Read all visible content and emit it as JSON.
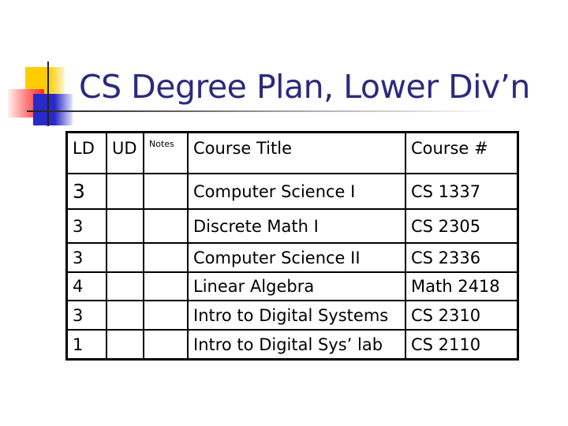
{
  "slide": {
    "title": "CS Degree Plan, Lower Div’n",
    "decoration_colors": {
      "yellow": "#ffcc00",
      "red": "#ff2a2a",
      "blue": "#2a2ac8",
      "title": "#2a2a7e"
    }
  },
  "table": {
    "headers": [
      "LD",
      "UD",
      "Notes",
      "Course Title",
      "Course #"
    ],
    "rows": [
      {
        "ld": "3",
        "ud": "",
        "notes": "",
        "title": "Computer Science I",
        "number": "CS 1337"
      },
      {
        "ld": "3",
        "ud": "",
        "notes": "",
        "title": "Discrete Math I",
        "number": "CS 2305"
      },
      {
        "ld": "3",
        "ud": "",
        "notes": "",
        "title": "Computer Science II",
        "number": "CS 2336"
      },
      {
        "ld": "4",
        "ud": "",
        "notes": "",
        "title": "Linear Algebra",
        "number": "Math 2418"
      },
      {
        "ld": "3",
        "ud": "",
        "notes": "",
        "title": "Intro to Digital Systems",
        "number": "CS 2310"
      },
      {
        "ld": "1",
        "ud": "",
        "notes": "",
        "title": "Intro to Digital Sys’ lab",
        "number": "CS 2110"
      }
    ]
  }
}
